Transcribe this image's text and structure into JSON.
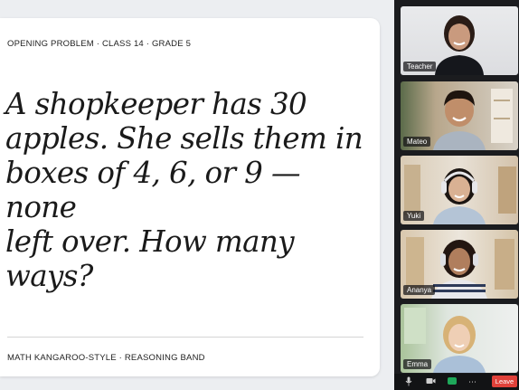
{
  "slide": {
    "header": "OPENING PROBLEM · CLASS 14 · GRADE 5",
    "problem_lines": [
      "A shopkeeper has 30",
      "apples. She sells them in",
      "boxes of 4, 6, or 9 — none",
      "left over. How many",
      "ways?"
    ],
    "footer": "MATH KANGAROO-STYLE · REASONING BAND"
  },
  "participants": [
    {
      "name": "Teacher"
    },
    {
      "name": "Mateo"
    },
    {
      "name": "Yuki"
    },
    {
      "name": "Ananya"
    },
    {
      "name": "Emma"
    }
  ],
  "controls": {
    "mic_icon": "microphone-icon",
    "camera_icon": "camera-icon",
    "share_icon": "share-screen-icon",
    "more_icon": "more-options-icon",
    "leave_label": "Leave",
    "leave_color": "#e0413a",
    "share_color": "#1ea85a"
  }
}
